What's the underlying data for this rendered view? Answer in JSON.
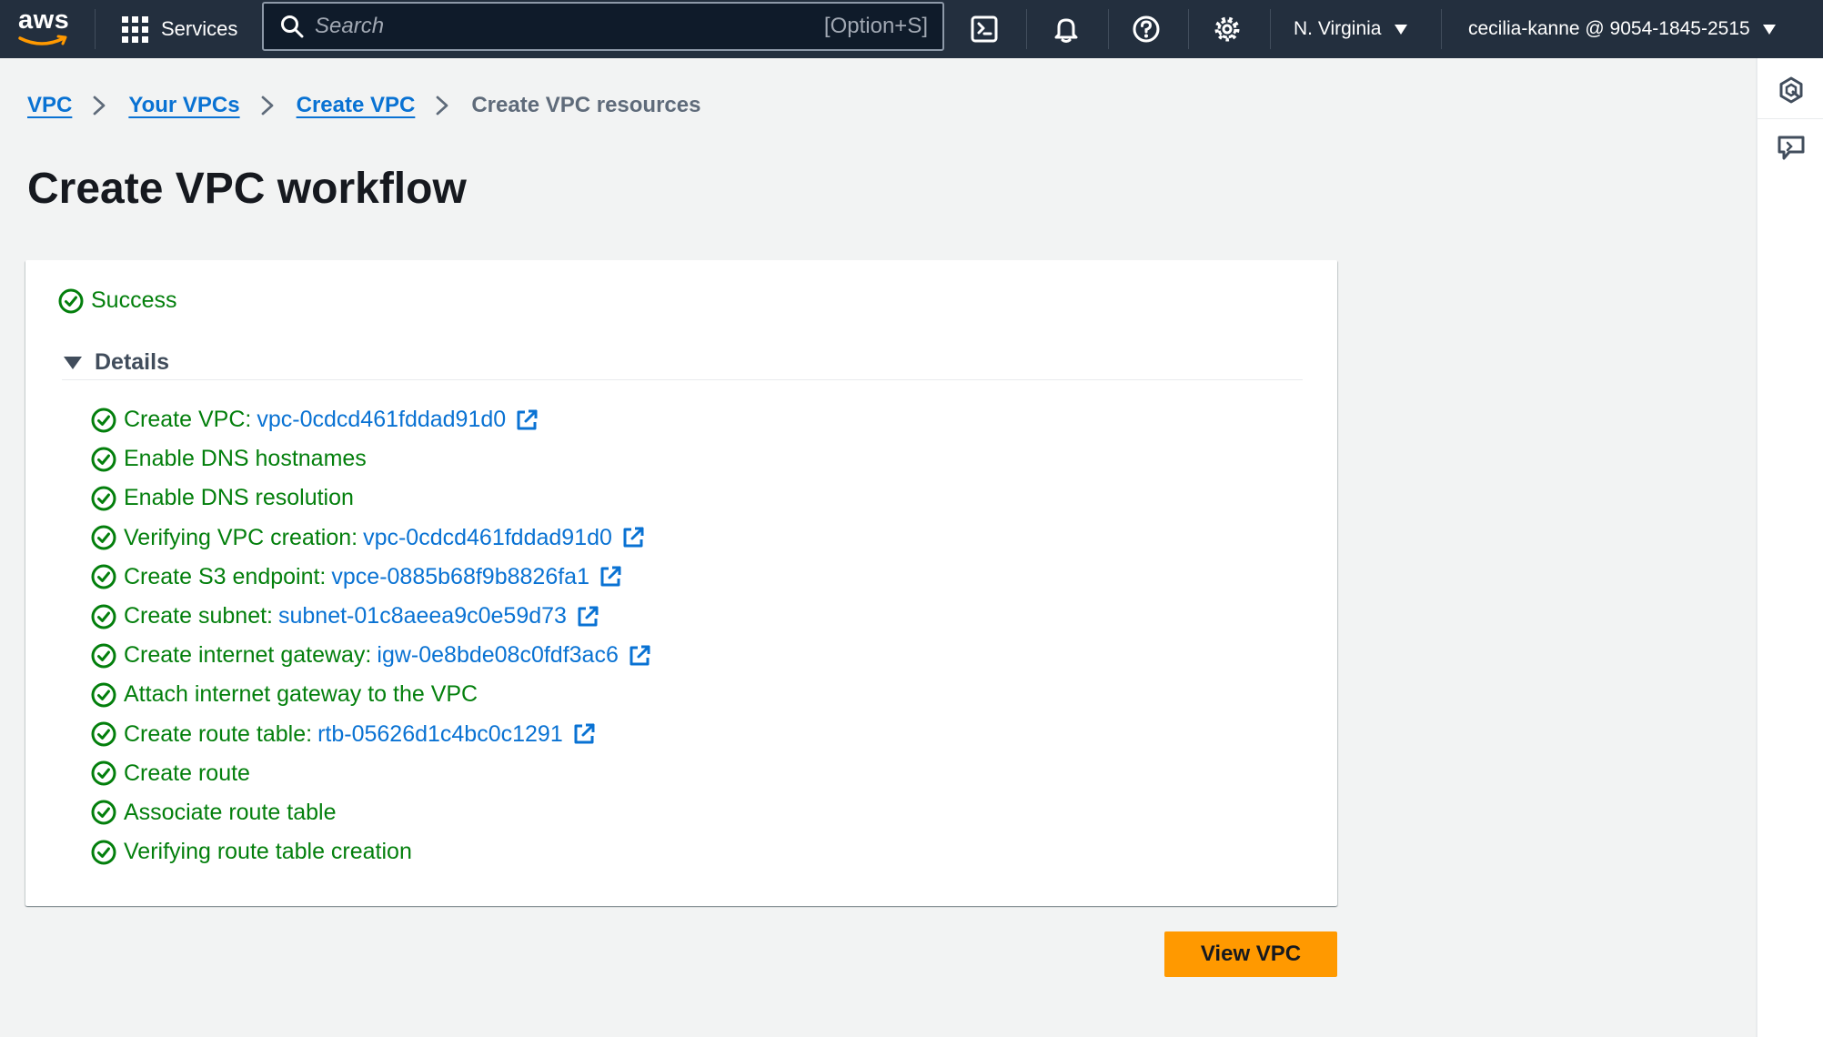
{
  "nav": {
    "logo_text": "aws",
    "services_label": "Services",
    "search_placeholder": "Search",
    "search_shortcut": "[Option+S]",
    "region": "N. Virginia",
    "account": "cecilia-kanne @ 9054-1845-2515",
    "icons": [
      "cloudshell-icon",
      "bell-icon",
      "help-icon",
      "gear-icon"
    ]
  },
  "breadcrumb": {
    "items": [
      "VPC",
      "Your VPCs",
      "Create VPC"
    ],
    "current": "Create VPC resources"
  },
  "page": {
    "title": "Create VPC workflow"
  },
  "status": {
    "label": "Success",
    "color": "#037f0c"
  },
  "details": {
    "heading": "Details",
    "items": [
      {
        "text": "Create VPC:",
        "link": "vpc-0cdcd461fddad91d0"
      },
      {
        "text": "Enable DNS hostnames",
        "link": ""
      },
      {
        "text": "Enable DNS resolution",
        "link": ""
      },
      {
        "text": "Verifying VPC creation:",
        "link": "vpc-0cdcd461fddad91d0"
      },
      {
        "text": "Create S3 endpoint:",
        "link": "vpce-0885b68f9b8826fa1"
      },
      {
        "text": "Create subnet:",
        "link": "subnet-01c8aeea9c0e59d73"
      },
      {
        "text": "Create internet gateway:",
        "link": "igw-0e8bde08c0fdf3ac6"
      },
      {
        "text": "Attach internet gateway to the VPC",
        "link": ""
      },
      {
        "text": "Create route table:",
        "link": "rtb-05626d1c4bc0c1291"
      },
      {
        "text": "Create route",
        "link": ""
      },
      {
        "text": "Associate route table",
        "link": ""
      },
      {
        "text": "Verifying route table creation",
        "link": ""
      }
    ]
  },
  "actions": {
    "view_vpc": "View VPC"
  },
  "colors": {
    "nav_bg": "#232f3e",
    "link": "#0972d3",
    "primary_button": "#ff9900",
    "success": "#037f0c"
  }
}
